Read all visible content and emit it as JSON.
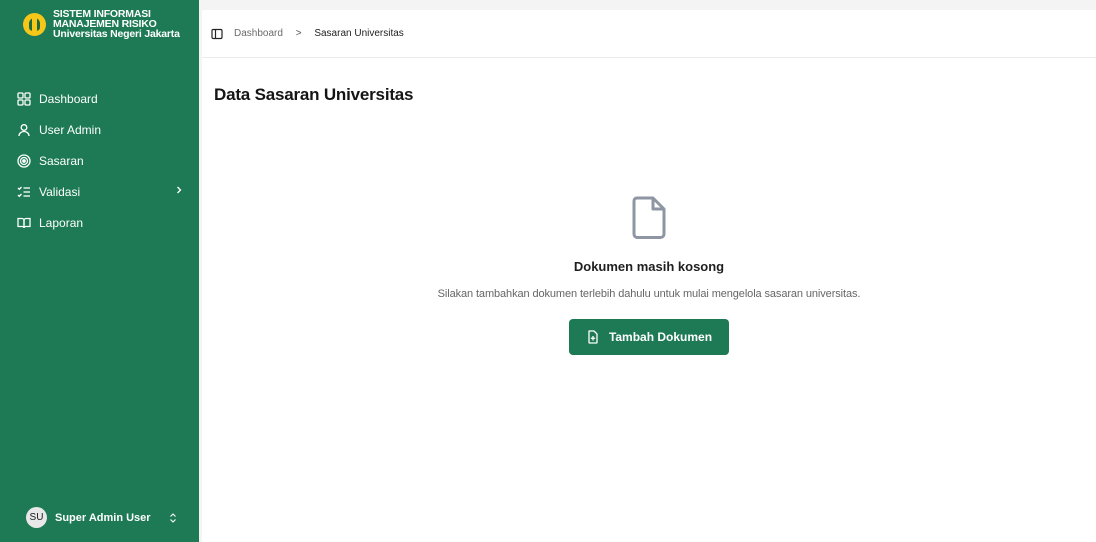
{
  "app": {
    "brand": {
      "line1": "SISTEM INFORMASI",
      "line2": "MANAJEMEN RISIKO",
      "line3": "Universitas Negeri Jakarta"
    },
    "accent_color": "#1d7a55",
    "logo_color": "#f6c619"
  },
  "sidebar": {
    "items": [
      {
        "label": "Dashboard",
        "icon": "grid-icon"
      },
      {
        "label": "User Admin",
        "icon": "user-icon"
      },
      {
        "label": "Sasaran",
        "icon": "target-icon"
      },
      {
        "label": "Validasi",
        "icon": "checklist-icon",
        "has_submenu": true
      },
      {
        "label": "Laporan",
        "icon": "book-open-icon"
      }
    ],
    "user": {
      "initials": "SU",
      "name": "Super Admin User"
    }
  },
  "breadcrumb": {
    "items": [
      "Dashboard",
      "Sasaran Universitas"
    ],
    "separator": ">"
  },
  "main": {
    "title": "Data Sasaran Universitas",
    "empty_state": {
      "title": "Dokumen masih kosong",
      "description": "Silakan tambahkan dokumen terlebih dahulu untuk mulai mengelola sasaran universitas.",
      "button_label": "Tambah Dokumen"
    }
  }
}
